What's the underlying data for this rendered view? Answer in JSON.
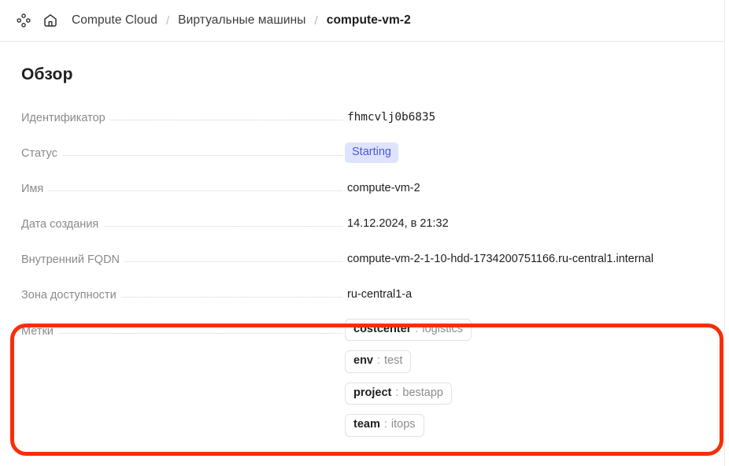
{
  "breadcrumb": {
    "services_icon": "services-grid-icon",
    "home_icon": "home-icon",
    "separator": "/",
    "items": [
      {
        "label": "Compute Cloud",
        "current": false
      },
      {
        "label": "Виртуальные машины",
        "current": false
      },
      {
        "label": "compute-vm-2",
        "current": true
      }
    ]
  },
  "page": {
    "title": "Обзор"
  },
  "overview": {
    "rows": [
      {
        "label": "Идентификатор",
        "value": "fhmcvlj0b6835",
        "type": "mono"
      },
      {
        "label": "Статус",
        "value": "Starting",
        "type": "badge"
      },
      {
        "label": "Имя",
        "value": "compute-vm-2",
        "type": "text"
      },
      {
        "label": "Дата создания",
        "value": "14.12.2024, в 21:32",
        "type": "text"
      },
      {
        "label": "Внутренний FQDN",
        "value": "compute-vm-2-1-10-hdd-1734200751166.ru-central1.internal",
        "type": "text"
      },
      {
        "label": "Зона доступности",
        "value": "ru-central1-a",
        "type": "text"
      }
    ],
    "labels_row": {
      "label": "Метки",
      "separator": ":",
      "chips": [
        {
          "key": "costcenter",
          "value": "logistics"
        },
        {
          "key": "env",
          "value": "test"
        },
        {
          "key": "project",
          "value": "bestapp"
        },
        {
          "key": "team",
          "value": "itops"
        }
      ]
    }
  },
  "annotation": {
    "shape": "rounded-rectangle",
    "color": "#f92d07",
    "targets": "labels-row"
  },
  "colors": {
    "badge_bg": "#dfe3fb",
    "badge_text": "#4a5ae0",
    "label_text": "#8a8a8a",
    "value_text": "#1f1f1f",
    "chip_border": "#e2e2e2",
    "annotation": "#f92d07"
  }
}
